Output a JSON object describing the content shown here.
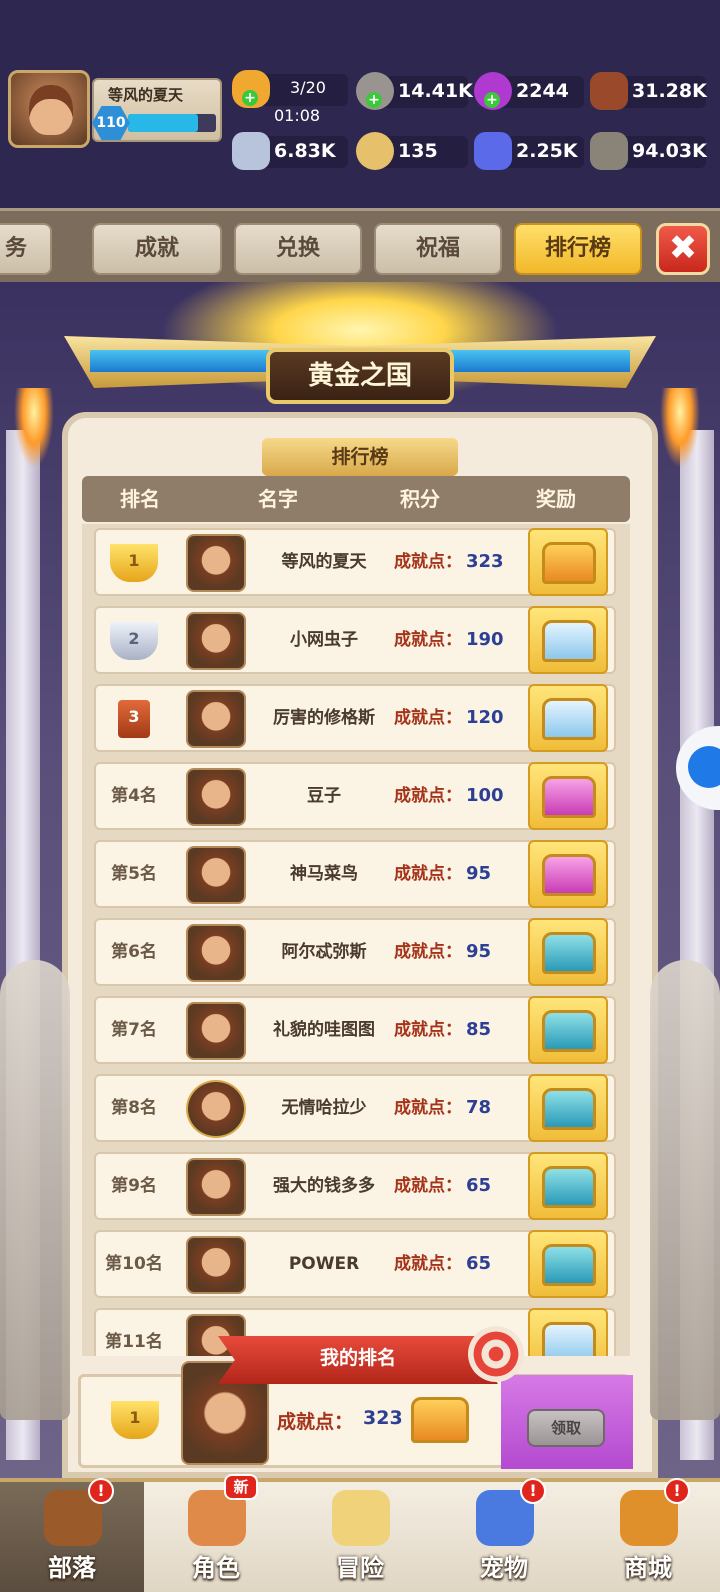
{
  "player": {
    "name": "等风的夏天",
    "level": "110",
    "xp_fraction": 0.8
  },
  "resources": {
    "stamina": {
      "value": "3/20",
      "timer": "01:08",
      "icon": "stamina-icon"
    },
    "stone": {
      "value": "14.41K",
      "icon": "stone-icon"
    },
    "orb": {
      "value": "2244",
      "icon": "purple-orb-icon"
    },
    "wood": {
      "value": "31.28K",
      "icon": "wood-logs-icon"
    },
    "bone": {
      "value": "6.83K",
      "icon": "bone-icon"
    },
    "coin": {
      "value": "135",
      "icon": "coin-icon"
    },
    "gem": {
      "value": "2.25K",
      "icon": "blue-gem-icon"
    },
    "ore": {
      "value": "94.03K",
      "icon": "ore-icon"
    }
  },
  "tabs": [
    {
      "label": "务",
      "active": false
    },
    {
      "label": "成就",
      "active": false
    },
    {
      "label": "兑换",
      "active": false
    },
    {
      "label": "祝福",
      "active": false
    },
    {
      "label": "排行榜",
      "active": true
    }
  ],
  "close_label": "✖",
  "banner_title": "黄金之国",
  "board_title": "排行榜",
  "columns": {
    "rank": "排名",
    "name": "名字",
    "score": "积分",
    "reward": "奖励"
  },
  "score_label": "成就点：",
  "rows": [
    {
      "rank": "1",
      "medal": "gold",
      "name": "等风的夏天",
      "score": "323",
      "chest": "gold"
    },
    {
      "rank": "2",
      "medal": "silver",
      "name": "小网虫子",
      "score": "190",
      "chest": "diamond"
    },
    {
      "rank": "3",
      "medal": "bronze",
      "name": "厉害的修格斯",
      "score": "120",
      "chest": "diamond"
    },
    {
      "rank": "第4名",
      "name": "豆子",
      "score": "100",
      "chest": "pink"
    },
    {
      "rank": "第5名",
      "name": "神马菜鸟",
      "score": "95",
      "chest": "pink"
    },
    {
      "rank": "第6名",
      "name": "阿尔忒弥斯",
      "score": "95",
      "chest": "teal"
    },
    {
      "rank": "第7名",
      "name": "礼貌的哇图图",
      "score": "85",
      "chest": "teal"
    },
    {
      "rank": "第8名",
      "name": "无情哈拉少",
      "score": "78",
      "chest": "teal",
      "round": true
    },
    {
      "rank": "第9名",
      "name": "强大的钱多多",
      "score": "65",
      "chest": "teal"
    },
    {
      "rank": "第10名",
      "name": "POWER",
      "score": "65",
      "chest": "teal"
    },
    {
      "rank": "第11名",
      "name": "",
      "score": "",
      "chest": "diamond",
      "partial": true
    }
  ],
  "my_rank": {
    "ribbon": "我的排名",
    "rank": "1",
    "score_label": "成就点：",
    "score": "323",
    "claim_label": "领取"
  },
  "nav": [
    {
      "label": "部落",
      "icon": "tribe-icon",
      "active": true,
      "badge": "!"
    },
    {
      "label": "角色",
      "icon": "character-icon",
      "active": false,
      "badge": "新"
    },
    {
      "label": "冒险",
      "icon": "map-icon",
      "active": false,
      "badge": ""
    },
    {
      "label": "宠物",
      "icon": "pet-icon",
      "active": false,
      "badge": "!"
    },
    {
      "label": "商城",
      "icon": "shop-icon",
      "active": false,
      "badge": "!"
    }
  ],
  "colors": {
    "accent": "#f2b82a",
    "score_blue": "#2c3f94",
    "label_red": "#a4331a",
    "claim_purple": "#c05ad8"
  }
}
